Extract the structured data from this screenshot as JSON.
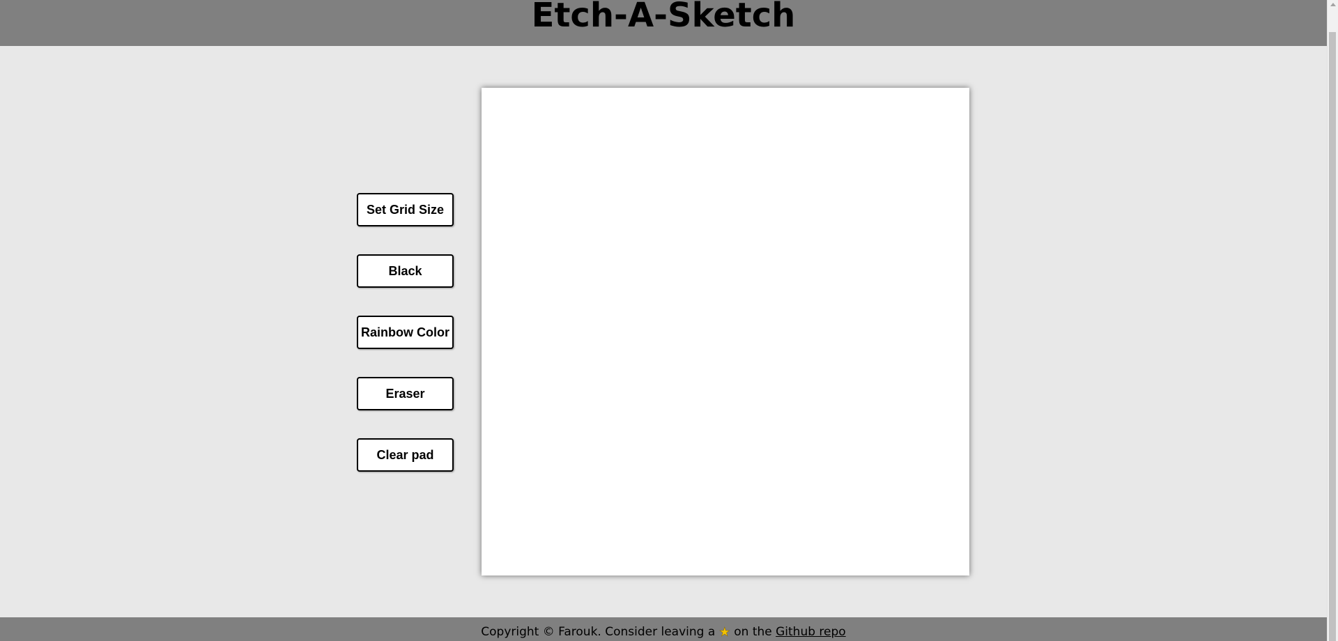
{
  "header": {
    "title": "Etch-A-Sketch"
  },
  "controls": {
    "buttons": [
      {
        "label": "Set Grid Size"
      },
      {
        "label": "Black"
      },
      {
        "label": "Rainbow Color"
      },
      {
        "label": "Eraser"
      },
      {
        "label": "Clear pad"
      }
    ]
  },
  "footer": {
    "text_before_star": "Copyright © Farouk. Consider leaving a",
    "star_icon": "star-icon",
    "text_after_star": "on the",
    "link_label": "Github repo"
  },
  "colors": {
    "header_bg": "#808080",
    "page_bg": "#e8e8e8",
    "pad_bg": "#ffffff",
    "footer_bg": "#808080"
  }
}
